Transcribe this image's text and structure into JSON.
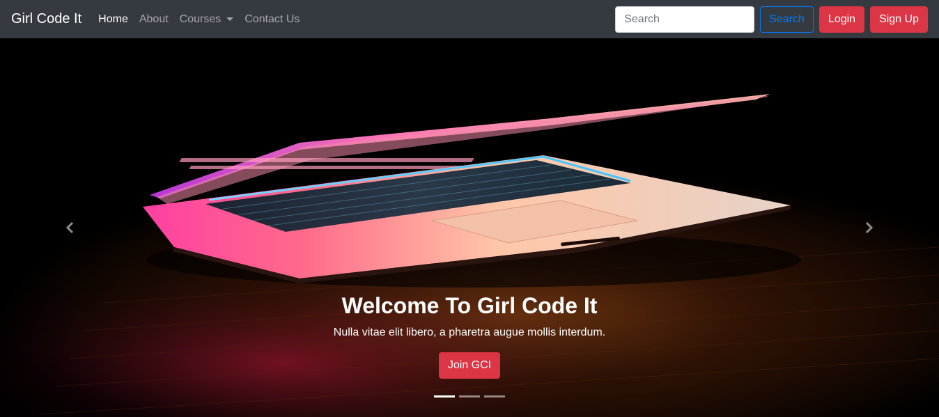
{
  "navbar": {
    "brand": "Girl Code It",
    "links": [
      {
        "label": "Home",
        "active": true
      },
      {
        "label": "About",
        "active": false
      },
      {
        "label": "Courses",
        "active": false,
        "dropdown": true
      },
      {
        "label": "Contact Us",
        "active": false
      }
    ],
    "search": {
      "placeholder": "Search",
      "value": "",
      "button_label": "Search"
    },
    "login_label": "Login",
    "signup_label": "Sign Up"
  },
  "carousel": {
    "caption": {
      "title": "Welcome To Girl Code It",
      "text": "Nulla vitae elit libero, a pharetra augue mollis interdum.",
      "button_label": "Join GCI"
    },
    "slide_count": 3,
    "active_slide": 1,
    "prev_icon": "chevron-left-icon",
    "next_icon": "chevron-right-icon"
  },
  "colors": {
    "navbar_bg": "#343a40",
    "primary": "#007bff",
    "danger": "#dc3545"
  }
}
